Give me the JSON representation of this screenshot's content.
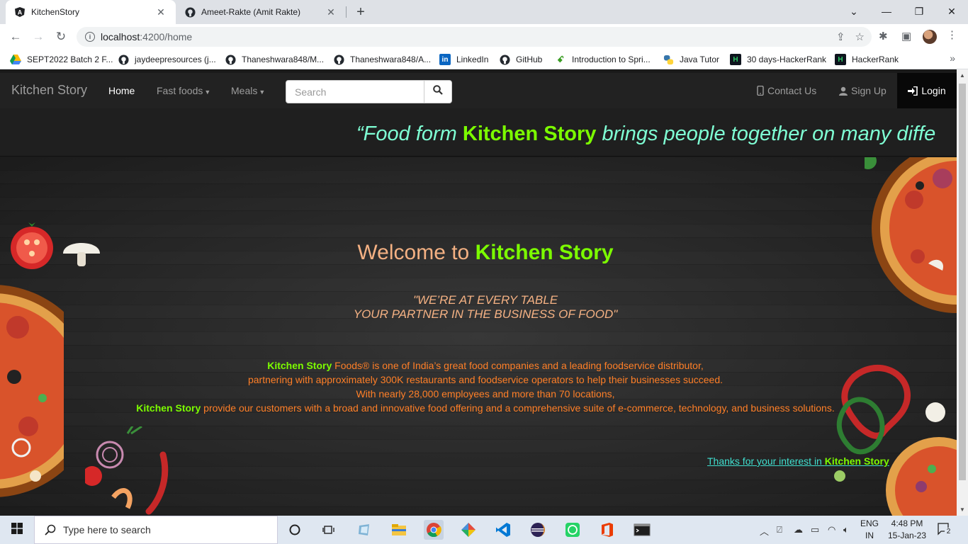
{
  "browser": {
    "tabs": [
      {
        "title": "KitchenStory",
        "icon": "angular-icon"
      },
      {
        "title": "Ameet-Rakte (Amit Rakte)",
        "icon": "github-icon"
      }
    ],
    "address": {
      "host": "localhost",
      "path": ":4200/home"
    },
    "bookmarks": [
      {
        "label": "SEPT2022 Batch 2 F...",
        "icon": "google-drive-icon"
      },
      {
        "label": "jaydeepresources (j...",
        "icon": "github-icon"
      },
      {
        "label": "Thaneshwara848/M...",
        "icon": "github-icon"
      },
      {
        "label": "Thaneshwara848/A...",
        "icon": "github-icon"
      },
      {
        "label": "LinkedIn",
        "icon": "linkedin-icon"
      },
      {
        "label": "GitHub",
        "icon": "github-icon"
      },
      {
        "label": "Introduction to Spri...",
        "icon": "spring-icon"
      },
      {
        "label": "Java Tutor",
        "icon": "python-icon"
      },
      {
        "label": "30 days-HackerRank",
        "icon": "hackerrank-icon"
      },
      {
        "label": "HackerRank",
        "icon": "hackerrank-icon"
      }
    ]
  },
  "site": {
    "brand": "Kitchen Story",
    "nav": {
      "home": "Home",
      "fast_foods": "Fast foods",
      "meals": "Meals"
    },
    "search_placeholder": "Search",
    "right": {
      "contact": "Contact Us",
      "signup": "Sign Up",
      "login": "Login"
    },
    "marquee": {
      "pre": "“Food form ",
      "brand": "Kitchen Story",
      "post": " brings people together on many diffe"
    },
    "welcome": {
      "pre": "Welcome to ",
      "brand": "Kitchen Story"
    },
    "tagline": {
      "line1": "\"WE’RE AT EVERY TABLE",
      "line2": "YOUR PARTNER IN THE BUSINESS OF FOOD\""
    },
    "description": {
      "brand": "Kitchen Story",
      "line1_rest": " Foods® is one of India’s great food companies and a leading foodservice distributor,",
      "line2": "partnering with approximately 300K restaurants and foodservice operators to help their businesses succeed.",
      "line3": "With nearly 28,000 employees and more than 70 locations,",
      "line4_rest": " provide our customers with a broad and innovative food offering and a comprehensive suite of e-commerce, technology, and business solutions."
    },
    "thanks": {
      "pre": "Thanks for your interest in ",
      "brand": "Kitchen Story"
    }
  },
  "taskbar": {
    "search_placeholder": "Type here to search",
    "language": {
      "line1": "ENG",
      "line2": "IN"
    },
    "time": "4:48 PM",
    "date": "15-Jan-23",
    "notifications": "2"
  },
  "colors": {
    "accent_green": "#7cfc00",
    "salmon": "#f4b183",
    "orange": "#ff7f27",
    "aqua": "#7fffd4",
    "turquoise": "#40e0d0"
  }
}
